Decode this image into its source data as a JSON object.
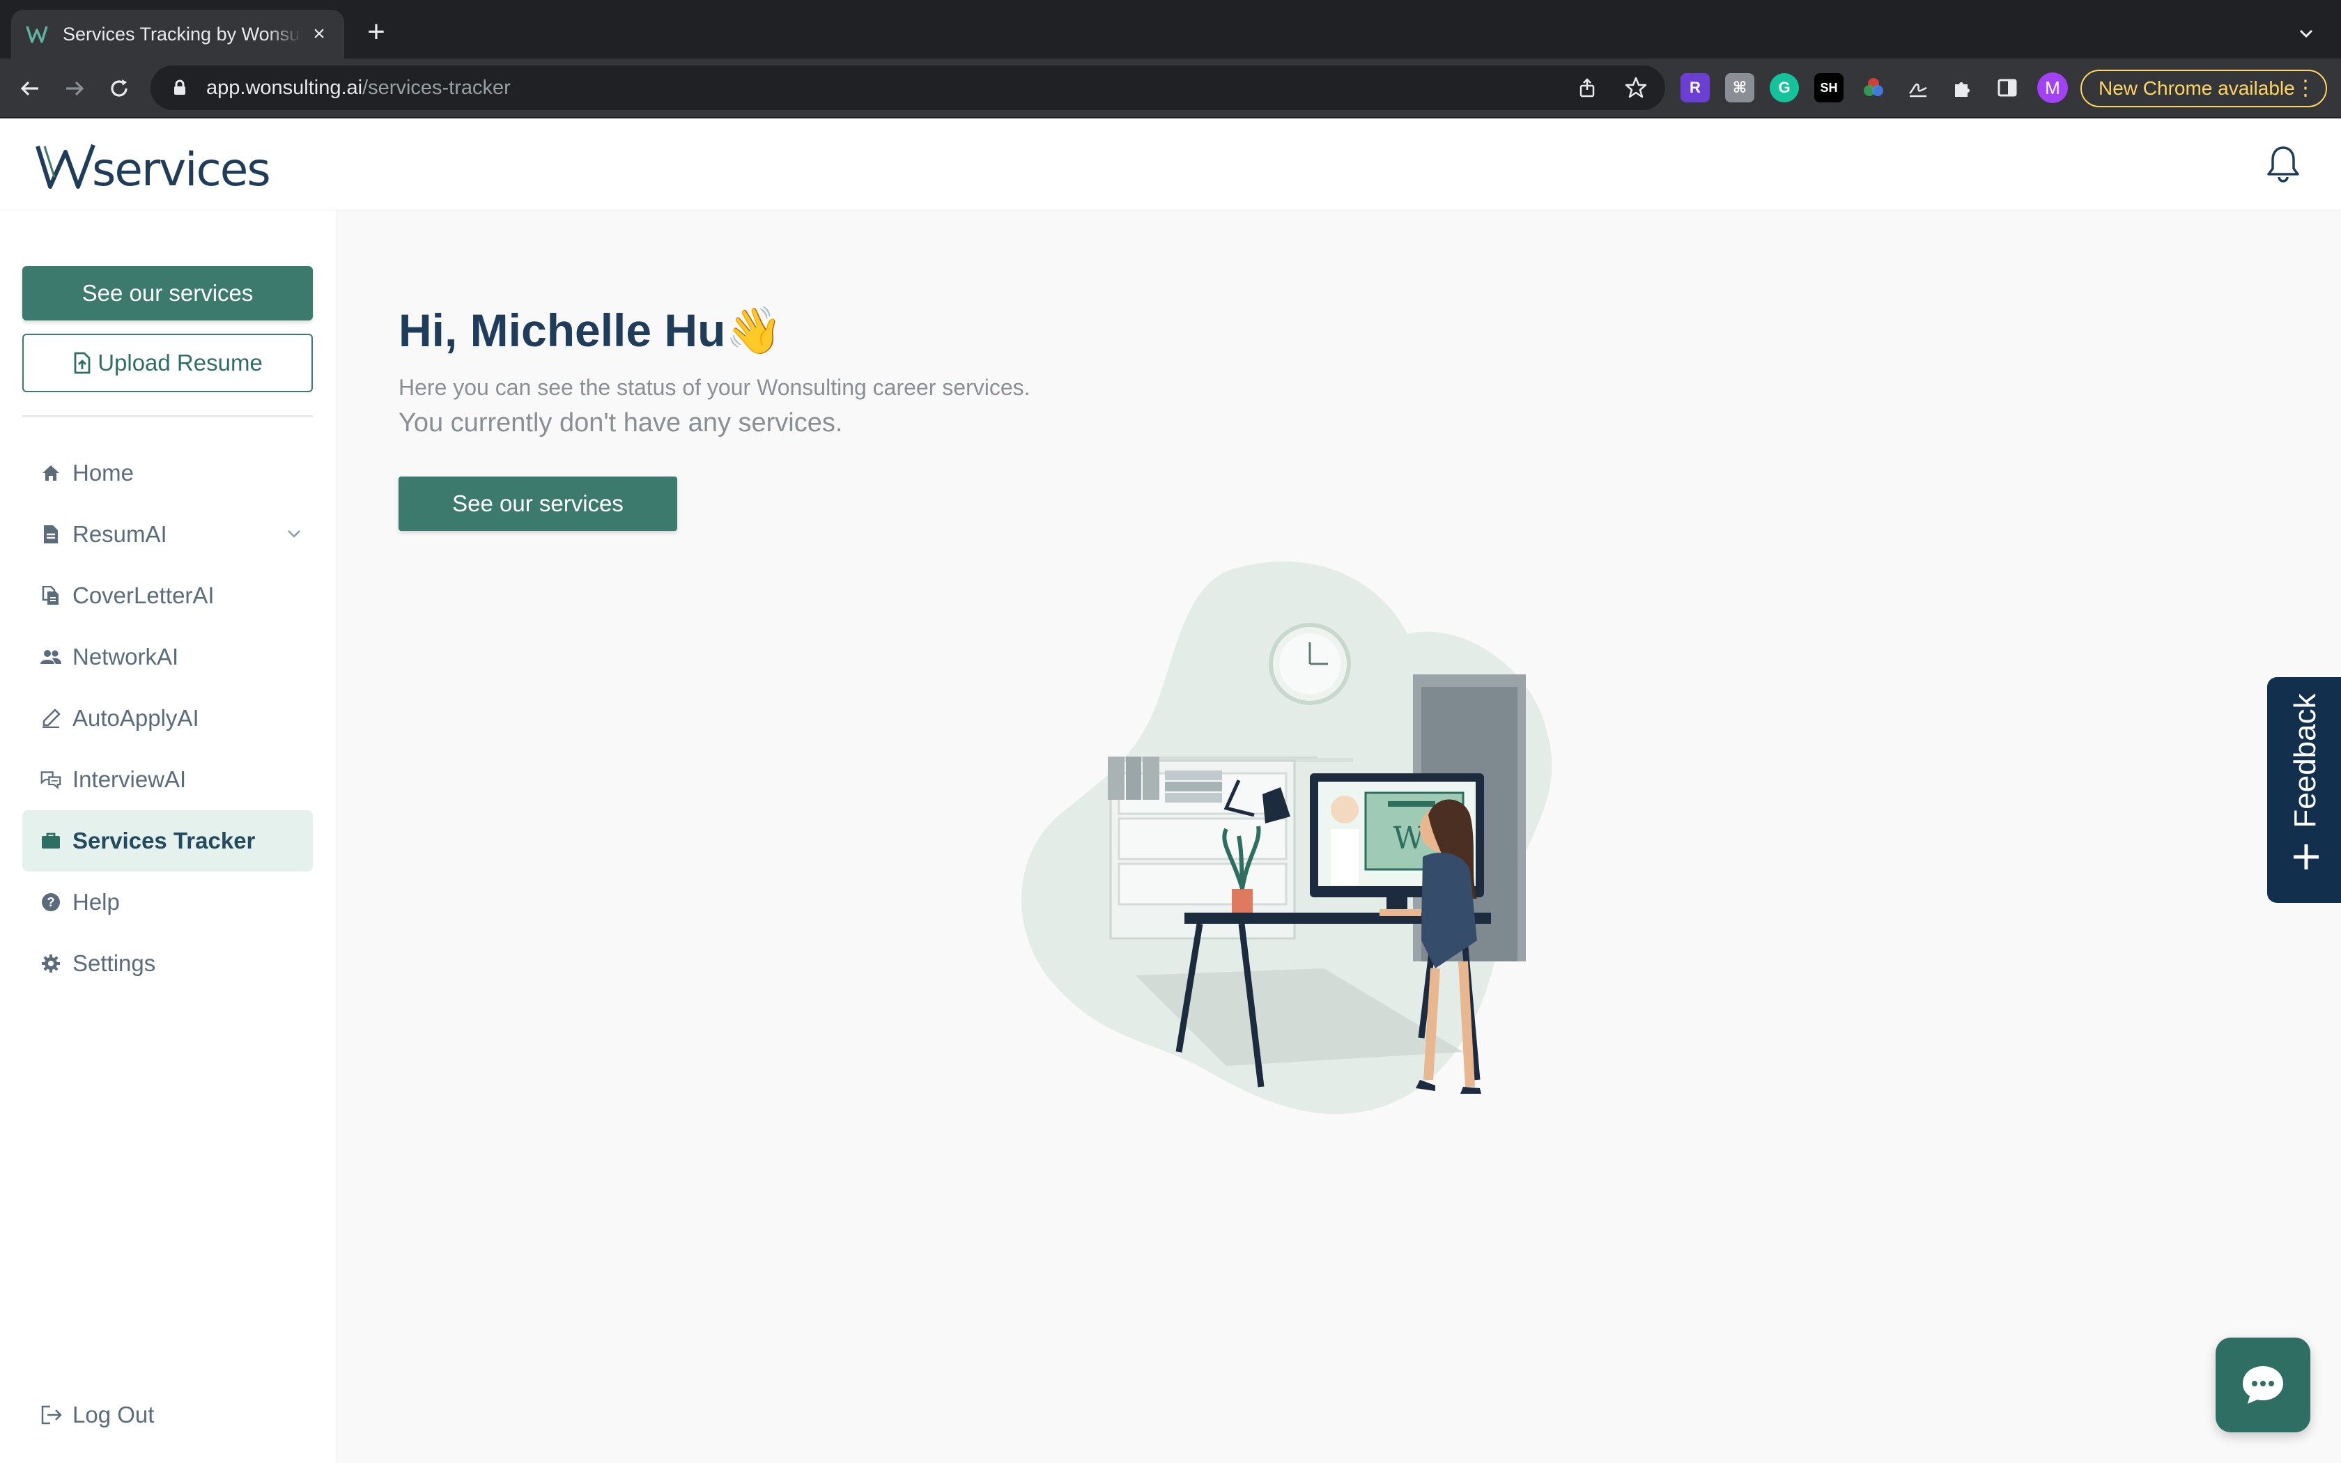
{
  "browser": {
    "tab_title": "Services Tracking by Wonsulting",
    "tab_close": "×",
    "new_tab": "+",
    "url_host": "app.wonsulting.ai",
    "url_path": "/services-tracker",
    "extensions": [
      {
        "label": "R",
        "color": "#6b3fd4"
      },
      {
        "label": "⌘",
        "color": "#8b8f95"
      },
      {
        "label": "G",
        "color": "#15c39a"
      },
      {
        "label": "SH",
        "color": "#000000"
      }
    ],
    "profile_initial": "M",
    "update_label": "New Chrome available",
    "update_color": "#fdd663"
  },
  "header": {
    "logo_text": "services"
  },
  "sidebar": {
    "primary_button": "See our services",
    "upload_button": "Upload Resume",
    "items": [
      {
        "label": "Home",
        "icon": "home-icon"
      },
      {
        "label": "ResumAI",
        "icon": "document-icon"
      },
      {
        "label": "CoverLetterAI",
        "icon": "files-icon"
      },
      {
        "label": "NetworkAI",
        "icon": "people-icon"
      },
      {
        "label": "AutoApplyAI",
        "icon": "pen-icon"
      },
      {
        "label": "InterviewAI",
        "icon": "chat-bubbles-icon"
      },
      {
        "label": "Services Tracker",
        "icon": "briefcase-icon"
      },
      {
        "label": "Help",
        "icon": "help-icon"
      },
      {
        "label": "Settings",
        "icon": "gear-icon"
      }
    ],
    "logout": "Log Out"
  },
  "main": {
    "greeting": "Hi, Michelle Hu👋",
    "subtitle": "Here you can see the status of your Wonsulting career services.",
    "empty_state": "You currently don't have any services.",
    "cta_button": "See our services"
  },
  "feedback": {
    "label": "Feedback"
  },
  "colors": {
    "brand_green": "#3d7a6e",
    "brand_navy": "#1f3d5a",
    "active_bg": "#e4f1ec",
    "feedback_bg": "#12304d"
  }
}
